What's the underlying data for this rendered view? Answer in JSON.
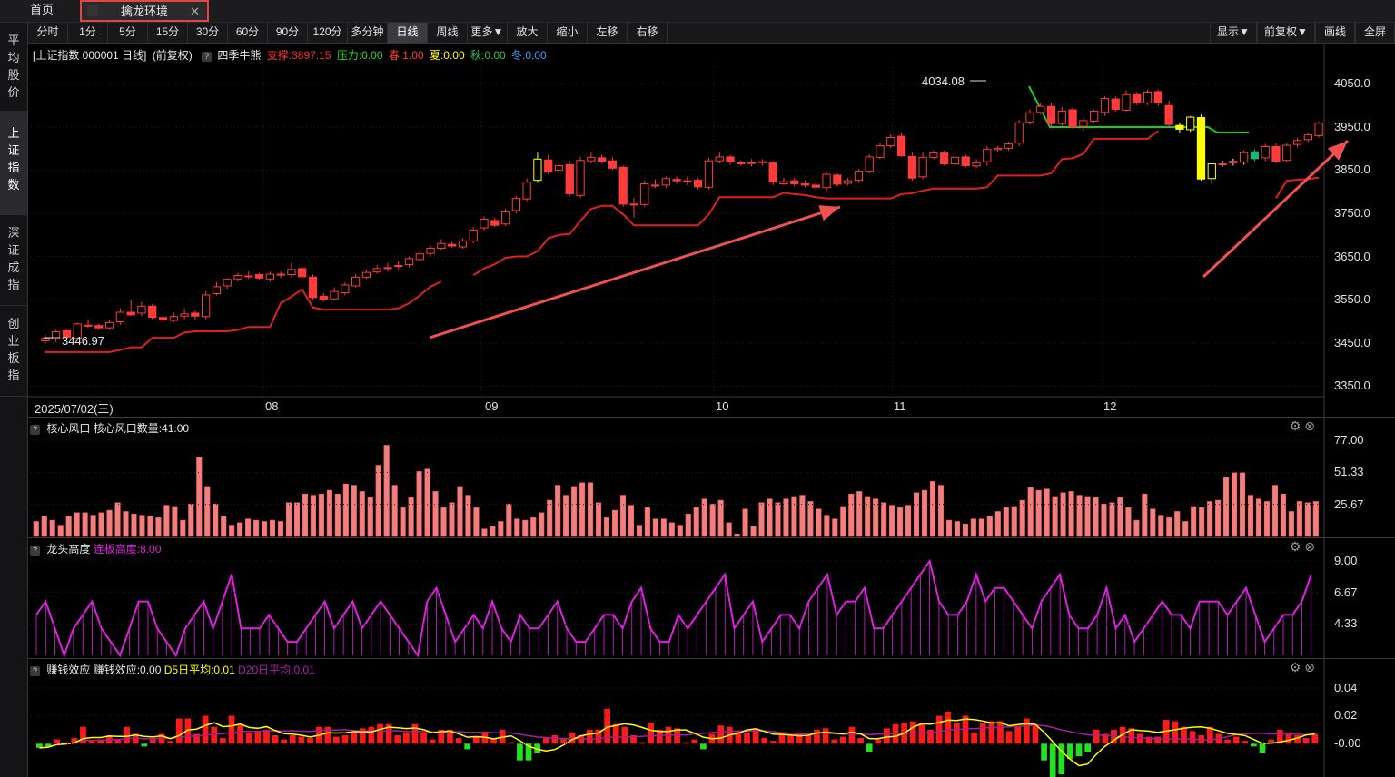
{
  "tabs": {
    "home": "首页",
    "active": "擒龙环境",
    "close": "✕"
  },
  "left_nav": [
    {
      "label": "平\n均\n股\n价"
    },
    {
      "label": "上\n证\n指\n数"
    },
    {
      "label": "深\n证\n成\n指"
    },
    {
      "label": "创\n业\n板\n指"
    }
  ],
  "toolbar": {
    "periods": [
      "分时",
      "1分",
      "5分",
      "15分",
      "30分",
      "60分",
      "90分",
      "120分",
      "多分钟",
      "日线",
      "周线",
      "更多▼",
      "放大",
      "缩小",
      "左移",
      "右移"
    ],
    "active_period": "日线",
    "right": [
      "显示▼",
      "前复权▼",
      "画线",
      "全屏"
    ]
  },
  "main_info": {
    "index": "[上证指数 000001 日线]",
    "adjust": "(前复权)",
    "help": "?",
    "indicator": "四季牛熊",
    "support": "支撑:3897.15",
    "pressure": "压力:0.00",
    "spring": "春:1.00",
    "summer": "夏:0.00",
    "autumn": "秋:0.00",
    "winter": "冬:0.00"
  },
  "colors": {
    "up": "#ff3b3b",
    "down": "#ff3b3b",
    "yellow": "#ffff00",
    "green": "#2ad12a",
    "teal": "#21b37a",
    "support_line": "#e02020",
    "pressure_line": "#18d018",
    "magenta": "#e020e0",
    "arrow": "#f05050"
  },
  "price_axis": [
    "4050.0",
    "3950.0",
    "3850.0",
    "3750.0",
    "3650.0",
    "3550.0",
    "3450.0",
    "3350.0"
  ],
  "date_axis": [
    "2025/07/02(三)",
    "08",
    "09",
    "10",
    "11",
    "12"
  ],
  "marks": {
    "high": "4034.08",
    "low": "3446.97"
  },
  "panels": {
    "core": {
      "title": "核心风口",
      "value": "核心风口数量:41.00",
      "axis": [
        "77.00",
        "51.33",
        "25.67"
      ]
    },
    "dragon": {
      "title": "龙头高度",
      "value": "连板高度:8.00",
      "axis": [
        "9.00",
        "6.67",
        "4.33"
      ]
    },
    "money": {
      "title": "赚钱效应",
      "value": "赚钱效应:0.00",
      "d5": "D5日平均:0.01",
      "d20": "D20日平均:0.01",
      "axis": [
        "0.04",
        "0.02",
        "-0.00"
      ]
    }
  },
  "tools": {
    "gear": "gear-icon",
    "close": "close-icon"
  },
  "chart_data": [
    {
      "type": "candlestick",
      "title": "上证指数 000001 日线",
      "ylim": [
        3330,
        4075
      ],
      "n": 120,
      "opens": [
        3455,
        3459,
        3478,
        3461,
        3491,
        3490,
        3485,
        3499,
        3521,
        3519,
        3535,
        3509,
        3502,
        3512,
        3519,
        3511,
        3564,
        3582,
        3598,
        3604,
        3608,
        3598,
        3607,
        3608,
        3622,
        3602,
        3558,
        3552,
        3566,
        3582,
        3602,
        3614,
        3622,
        3628,
        3631,
        3643,
        3657,
        3669,
        3678,
        3672,
        3686,
        3716,
        3733,
        3725,
        3756,
        3783,
        3826,
        3873,
        3849,
        3862,
        3791,
        3871,
        3878,
        3871,
        3856,
        3771,
        3770,
        3815,
        3815,
        3828,
        3824,
        3826,
        3810,
        3871,
        3880,
        3867,
        3867,
        3869,
        3866,
        3818,
        3825,
        3818,
        3815,
        3809,
        3838,
        3819,
        3826,
        3847,
        3879,
        3906,
        3928,
        3881,
        3834,
        3879,
        3889,
        3864,
        3880,
        3859,
        3869,
        3897,
        3900,
        3912,
        3961,
        3983,
        3997,
        3957,
        3989,
        3951,
        3963,
        3983,
        4014,
        3988,
        4024,
        4005,
        4031,
        3999,
        3953,
        3943,
        3971,
        3830,
        3862,
        3866,
        3868,
        3892,
        3878,
        3904,
        3872,
        3909,
        3920,
        3929
      ],
      "closes": [
        3461,
        3476,
        3463,
        3494,
        3490,
        3485,
        3497,
        3521,
        3515,
        3535,
        3509,
        3503,
        3511,
        3517,
        3512,
        3561,
        3580,
        3597,
        3606,
        3605,
        3600,
        3609,
        3609,
        3620,
        3603,
        3555,
        3551,
        3569,
        3584,
        3602,
        3613,
        3622,
        3624,
        3629,
        3645,
        3656,
        3669,
        3680,
        3674,
        3686,
        3711,
        3736,
        3722,
        3753,
        3784,
        3822,
        3875,
        3845,
        3860,
        3795,
        3872,
        3879,
        3870,
        3854,
        3771,
        3771,
        3818,
        3814,
        3830,
        3825,
        3825,
        3811,
        3871,
        3880,
        3869,
        3864,
        3866,
        3867,
        3822,
        3823,
        3818,
        3815,
        3810,
        3840,
        3817,
        3825,
        3847,
        3880,
        3906,
        3925,
        3883,
        3831,
        3879,
        3889,
        3864,
        3879,
        3860,
        3866,
        3898,
        3900,
        3910,
        3959,
        3982,
        3997,
        3957,
        3986,
        3950,
        3964,
        3986,
        4015,
        3990,
        4024,
        4005,
        4030,
        4005,
        3955,
        3944,
        3972,
        3829,
        3864,
        3864,
        3870,
        3890,
        3876,
        3904,
        3870,
        3907,
        3918,
        3931,
        3958
      ],
      "highs": [
        3470,
        3480,
        3482,
        3497,
        3505,
        3495,
        3502,
        3530,
        3550,
        3545,
        3540,
        3512,
        3520,
        3530,
        3525,
        3570,
        3590,
        3600,
        3612,
        3615,
        3612,
        3615,
        3615,
        3635,
        3628,
        3608,
        3565,
        3578,
        3590,
        3610,
        3620,
        3630,
        3635,
        3640,
        3650,
        3665,
        3675,
        3690,
        3685,
        3692,
        3718,
        3742,
        3740,
        3760,
        3790,
        3830,
        3890,
        3885,
        3872,
        3870,
        3880,
        3890,
        3885,
        3880,
        3860,
        3785,
        3825,
        3828,
        3835,
        3835,
        3835,
        3832,
        3878,
        3890,
        3885,
        3872,
        3875,
        3875,
        3870,
        3832,
        3832,
        3826,
        3822,
        3845,
        3842,
        3832,
        3852,
        3886,
        3912,
        3932,
        3935,
        3890,
        3890,
        3895,
        3895,
        3888,
        3886,
        3875,
        3905,
        3905,
        3915,
        3965,
        3990,
        4005,
        4005,
        3995,
        3995,
        3970,
        3990,
        4020,
        4020,
        4034,
        4030,
        4035,
        4035,
        4010,
        3960,
        3975,
        3978,
        3845,
        3872,
        3876,
        3894,
        3898,
        3910,
        3912,
        3912,
        3925,
        3935,
        3962
      ],
      "lows": [
        3447,
        3452,
        3458,
        3458,
        3485,
        3480,
        3480,
        3492,
        3512,
        3512,
        3505,
        3495,
        3498,
        3505,
        3505,
        3505,
        3560,
        3575,
        3592,
        3598,
        3595,
        3592,
        3600,
        3602,
        3598,
        3550,
        3545,
        3548,
        3560,
        3578,
        3598,
        3610,
        3615,
        3620,
        3625,
        3640,
        3650,
        3665,
        3670,
        3668,
        3680,
        3710,
        3718,
        3720,
        3750,
        3778,
        3820,
        3840,
        3842,
        3790,
        3785,
        3865,
        3865,
        3850,
        3765,
        3740,
        3765,
        3808,
        3808,
        3818,
        3815,
        3805,
        3805,
        3865,
        3862,
        3860,
        3858,
        3860,
        3815,
        3815,
        3812,
        3810,
        3805,
        3802,
        3812,
        3814,
        3820,
        3842,
        3875,
        3900,
        3880,
        3825,
        3828,
        3875,
        3860,
        3858,
        3856,
        3855,
        3860,
        3893,
        3895,
        3905,
        3955,
        3978,
        3950,
        3950,
        3945,
        3940,
        3958,
        3975,
        3985,
        3985,
        4000,
        4000,
        3998,
        3950,
        3935,
        3938,
        3825,
        3818,
        3858,
        3860,
        3862,
        3870,
        3870,
        3865,
        3868,
        3902,
        3915,
        3925
      ]
    },
    {
      "type": "bar",
      "title": "核心风口",
      "ylim": [
        0,
        77
      ],
      "values": [
        12,
        16,
        13,
        9,
        16,
        19,
        19,
        17,
        19,
        21,
        27,
        20,
        18,
        17,
        16,
        15,
        25,
        24,
        13,
        26,
        63,
        40,
        26,
        16,
        9,
        11,
        14,
        13,
        12,
        13,
        12,
        27,
        27,
        34,
        33,
        34,
        37,
        34,
        42,
        41,
        36,
        31,
        57,
        73,
        41,
        23,
        31,
        52,
        54,
        36,
        23,
        27,
        40,
        33,
        23,
        6,
        8,
        12,
        26,
        14,
        13,
        15,
        19,
        29,
        41,
        33,
        40,
        43,
        43,
        27,
        15,
        21,
        33,
        25,
        9,
        23,
        14,
        14,
        11,
        9,
        18,
        23,
        30,
        26,
        29,
        11,
        2,
        22,
        8,
        27,
        30,
        27,
        30,
        32,
        33,
        28,
        22,
        17,
        14,
        24,
        34,
        36,
        32,
        30,
        27,
        25,
        23,
        25,
        35,
        37,
        44,
        41,
        13,
        12,
        10,
        14,
        14,
        16,
        20,
        23,
        24,
        29,
        39,
        37,
        38,
        32,
        35,
        36,
        33,
        32,
        31,
        26,
        27,
        31,
        23,
        13,
        34,
        22,
        17,
        15,
        20,
        12,
        24,
        23,
        28,
        29,
        47,
        51,
        51,
        33,
        30,
        28,
        41,
        34,
        20,
        28,
        27,
        28
      ]
    },
    {
      "type": "line",
      "title": "龙头高度",
      "ylim": [
        2,
        9
      ],
      "values": [
        5,
        6,
        4,
        2,
        4,
        5,
        6,
        4,
        3,
        2,
        4,
        6,
        6,
        4,
        3,
        2,
        4,
        5,
        6,
        4,
        6,
        8,
        4,
        4,
        4,
        5,
        4,
        3,
        3,
        4,
        5,
        6,
        4,
        5,
        6,
        4,
        5,
        6,
        5,
        4,
        3,
        2,
        6,
        7,
        5,
        3,
        4,
        5,
        4,
        6,
        4,
        3,
        5,
        4,
        4,
        5,
        6,
        4,
        3,
        3,
        4,
        5,
        5,
        4,
        6,
        7,
        4,
        3,
        3,
        5,
        4,
        5,
        6,
        7,
        8,
        4,
        5,
        6,
        3,
        4,
        5,
        5,
        4,
        6,
        7,
        8,
        5,
        6,
        6,
        7,
        4,
        4,
        5,
        6,
        7,
        8,
        9,
        6,
        5,
        5,
        6,
        8,
        6,
        7,
        7,
        6,
        5,
        4,
        6,
        7,
        8,
        5,
        4,
        4,
        5,
        7,
        4,
        5,
        3,
        4,
        5,
        6,
        5,
        5,
        4,
        6,
        6,
        6,
        5,
        6,
        7,
        5,
        3,
        4,
        5,
        5,
        6,
        8
      ]
    },
    {
      "type": "bar",
      "title": "赚钱效应",
      "ylim": [
        -0.02,
        0.045
      ],
      "values": [
        -0.003,
        -0.002,
        0.003,
        0.001,
        0.004,
        0.012,
        0.002,
        0.003,
        0.006,
        0.003,
        0.012,
        0.007,
        -0.002,
        0.004,
        0.007,
        0.002,
        0.018,
        0.018,
        0.007,
        0.02,
        0.012,
        0.004,
        0.02,
        0.014,
        0.008,
        0.009,
        0.01,
        0.006,
        0.003,
        0.006,
        0.005,
        0.004,
        0.012,
        0.012,
        0.005,
        0.006,
        0.008,
        0.011,
        0.012,
        0.014,
        0.014,
        0.006,
        0.008,
        0.014,
        0.008,
        0.003,
        0.01,
        0.01,
        0.004,
        -0.004,
        0.005,
        0.008,
        0.004,
        0.01,
        0.001,
        -0.012,
        -0.012,
        -0.007,
        0.004,
        0.006,
        0.004,
        0.008,
        0.006,
        0.01,
        0.01,
        0.025,
        0.014,
        0.012,
        0.006,
        0.001,
        0.015,
        0.01,
        0.012,
        0.011,
        0.001,
        0.003,
        -0.004,
        0.007,
        0.013,
        0.012,
        0.009,
        0.008,
        0.011,
        0.004,
        0.002,
        0.008,
        0.006,
        0.008,
        0.006,
        0.01,
        0.011,
        0.003,
        0.005,
        0.012,
        0.004,
        -0.006,
        0.003,
        0.011,
        0.014,
        0.015,
        0.016,
        0.015,
        0.01,
        0.02,
        0.023,
        0.015,
        0.02,
        0.008,
        0.015,
        0.016,
        0.016,
        0.009,
        0.012,
        0.018,
        0.014,
        -0.012,
        -0.025,
        -0.022,
        -0.011,
        -0.009,
        -0.006,
        0.01,
        0.007,
        0.01,
        0.012,
        0.011,
        0.007,
        0.005,
        0.005,
        0.017,
        0.016,
        0.012,
        0.009,
        0.006,
        0.012,
        0.007,
        0.003,
        0.005,
        0.002,
        -0.002,
        -0.007,
        0.003,
        0.01,
        0.008,
        0.006,
        0.004,
        0.007
      ]
    }
  ]
}
